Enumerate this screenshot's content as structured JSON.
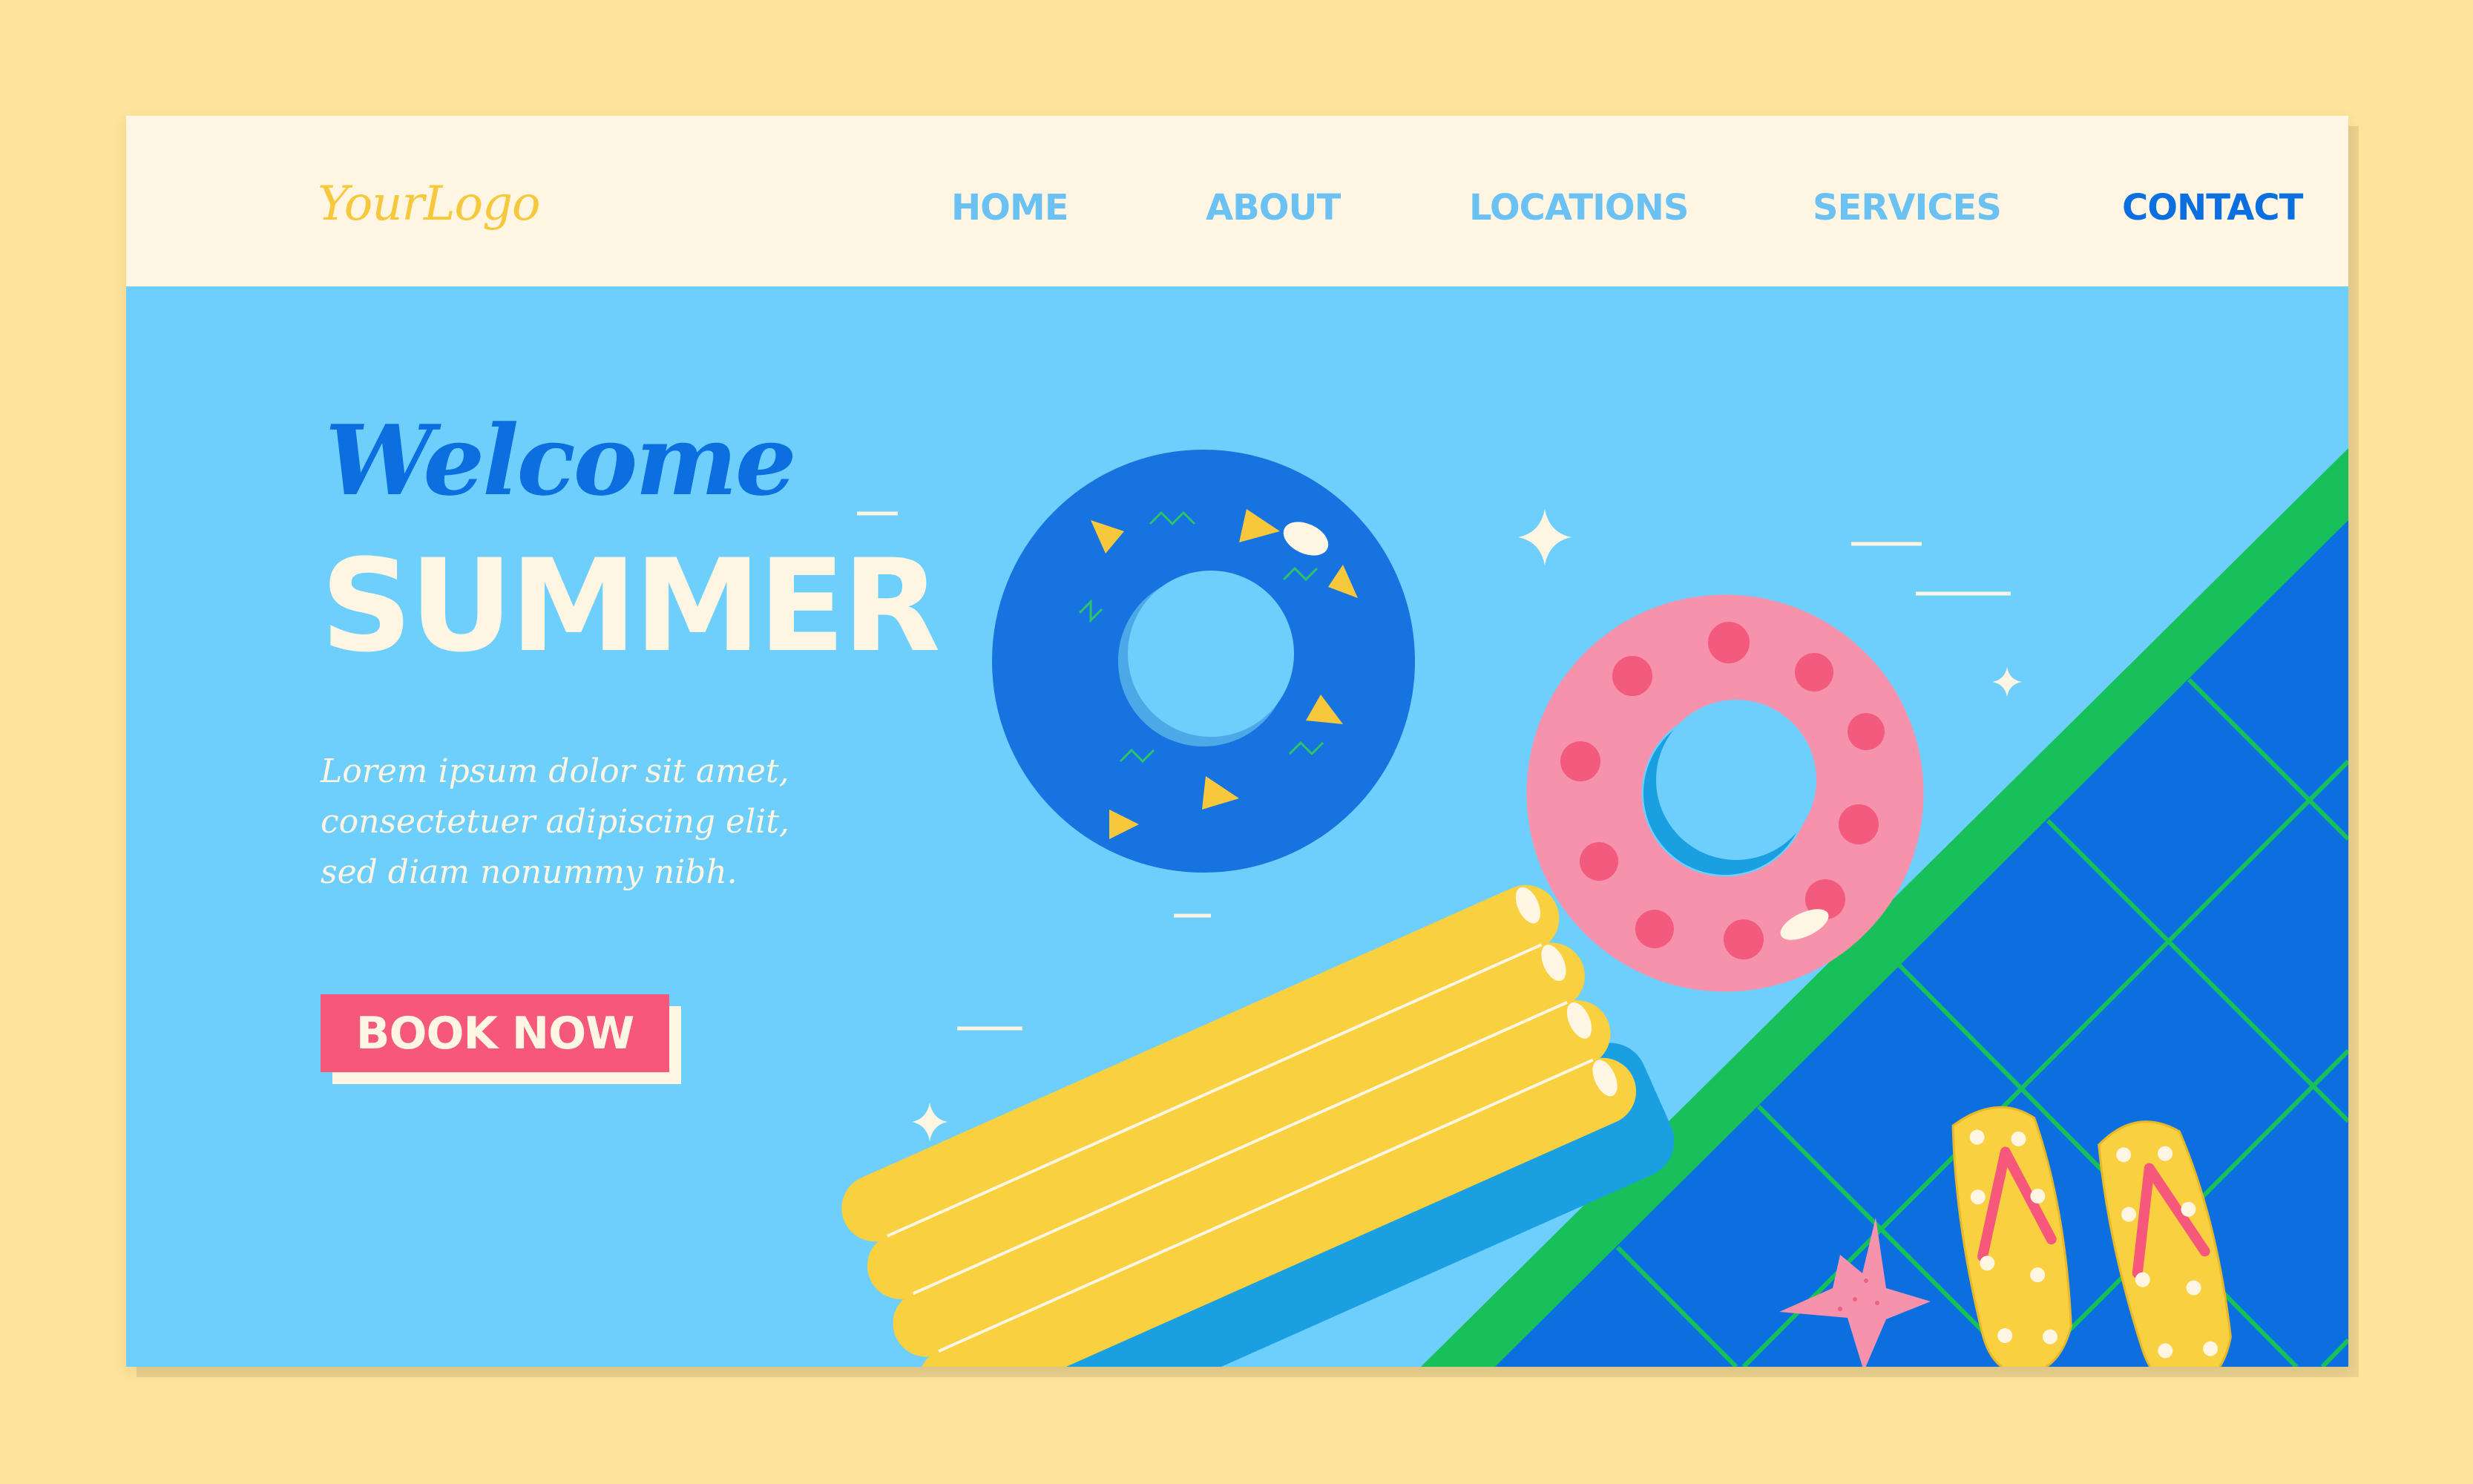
{
  "navbar": {
    "logo": "YourLogo",
    "links": [
      "HOME",
      "ABOUT",
      "LOCATIONS",
      "SERVICES",
      "CONTACT"
    ]
  },
  "hero": {
    "welcome": "Welcome",
    "title": "SUMMER",
    "tagline": "Lorem ipsum dolor sit amet, consectetuer adipiscing elit, sed diam nonummy nibh.",
    "button_label": "BOOK NOW"
  },
  "colors": {
    "page_background": "#FEE39A",
    "navbar_background": "#FEF6E3",
    "water": "#6ECFFC",
    "nav_link": "#6BC2F2",
    "nav_link_active": "#0B6FE0",
    "accent_pink": "#F5587A",
    "logo_yellow": "#F7C83C",
    "pool_tile_blue": "#0B6FE0",
    "pool_edge_green": "#18C05A"
  },
  "icons": [
    "swim-ring-blue-icon",
    "swim-ring-pink-icon",
    "air-mattress-icon",
    "starfish-icon",
    "flip-flops-icon",
    "sparkle-icon"
  ]
}
